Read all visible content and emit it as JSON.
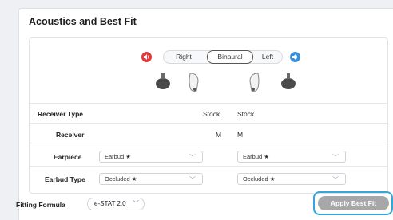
{
  "section": {
    "title": "Acoustics and Best Fit"
  },
  "ear_selector": {
    "options": [
      "Right",
      "Binaural",
      "Left"
    ],
    "selected": "Binaural",
    "colors": {
      "right": "#e2393d",
      "left": "#3a8fd8"
    }
  },
  "rows": {
    "receiver_type": {
      "label": "Receiver Type",
      "right": "Stock",
      "left": "Stock"
    },
    "receiver": {
      "label": "Receiver",
      "right": "M",
      "left": "M"
    },
    "earpiece": {
      "label": "Earpiece",
      "right": "Earbud ★",
      "left": "Earbud ★"
    },
    "earbud_type": {
      "label": "Earbud Type",
      "right": "Occluded ★",
      "left": "Occluded ★"
    }
  },
  "fitting_formula": {
    "label": "Fitting Formula",
    "value": "e-STAT 2.0"
  },
  "actions": {
    "apply_best_fit": "Apply Best Fit"
  },
  "accent": "#36a6d9"
}
